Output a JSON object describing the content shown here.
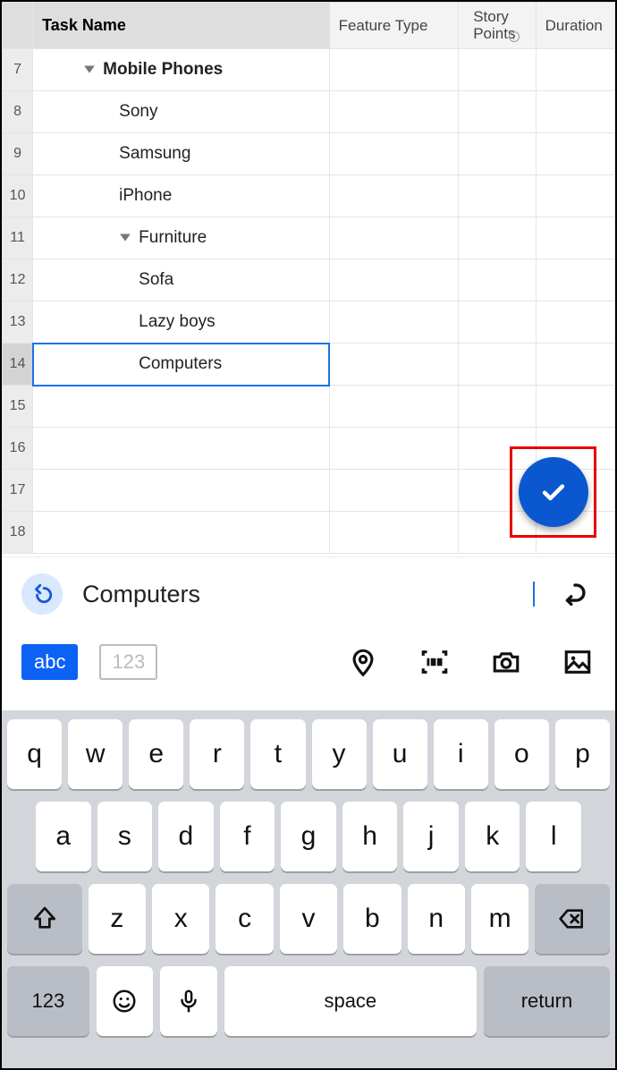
{
  "headers": {
    "task": "Task Name",
    "feature_type": "Feature Type",
    "story_points_l1": "Story",
    "story_points_l2": "Points",
    "duration": "Duration"
  },
  "rows": [
    {
      "n": "7",
      "label": "Mobile Phones",
      "indent": 1,
      "collapsible": true,
      "bold": true
    },
    {
      "n": "8",
      "label": "Sony",
      "indent": 2,
      "collapsible": false,
      "bold": false
    },
    {
      "n": "9",
      "label": "Samsung",
      "indent": 2,
      "collapsible": false,
      "bold": false
    },
    {
      "n": "10",
      "label": "iPhone",
      "indent": 2,
      "collapsible": false,
      "bold": false
    },
    {
      "n": "11",
      "label": "Furniture",
      "indent": 2,
      "collapsible": true,
      "bold": false
    },
    {
      "n": "12",
      "label": "Sofa",
      "indent": 3,
      "collapsible": false,
      "bold": false
    },
    {
      "n": "13",
      "label": "Lazy boys",
      "indent": 3,
      "collapsible": false,
      "bold": false
    },
    {
      "n": "14",
      "label": "Computers",
      "indent": 3,
      "collapsible": false,
      "bold": false,
      "selected": true
    },
    {
      "n": "15",
      "label": "",
      "indent": 0
    },
    {
      "n": "16",
      "label": "",
      "indent": 0
    },
    {
      "n": "17",
      "label": "",
      "indent": 0
    },
    {
      "n": "18",
      "label": "",
      "indent": 0
    }
  ],
  "input": {
    "value": "Computers",
    "mode_abc": "abc",
    "mode_123": "123"
  },
  "keyboard": {
    "row1": [
      "q",
      "w",
      "e",
      "r",
      "t",
      "y",
      "u",
      "i",
      "o",
      "p"
    ],
    "row2": [
      "a",
      "s",
      "d",
      "f",
      "g",
      "h",
      "j",
      "k",
      "l"
    ],
    "row3": [
      "z",
      "x",
      "c",
      "v",
      "b",
      "n",
      "m"
    ],
    "numkey": "123",
    "space": "space",
    "return": "return"
  }
}
